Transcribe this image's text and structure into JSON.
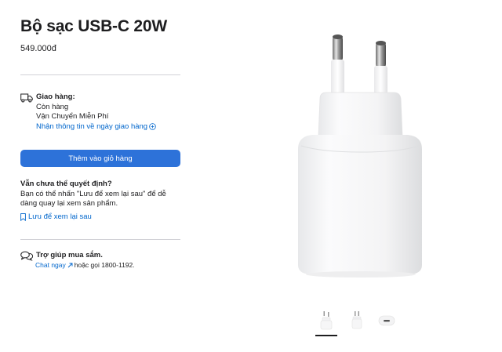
{
  "product": {
    "title": "Bộ sạc USB-C 20W",
    "price": "549.000đ"
  },
  "delivery": {
    "icon": "truck-icon",
    "heading": "Giao hàng:",
    "stock": "Còn hàng",
    "shipping": "Vận Chuyển Miễn Phí",
    "link_label": "Nhận thông tin về ngày giao hàng"
  },
  "cta": {
    "add_to_bag_label": "Thêm vào giỏ hàng",
    "color": "#2d72d9"
  },
  "save": {
    "heading": "Vẫn chưa thể quyết định?",
    "body_line1": "Bạn có thể nhấn \"Lưu để xem lại sau\" để dễ",
    "body_line2": "dàng quay lại xem sản phẩm.",
    "icon": "bookmark-icon",
    "link_label": "Lưu để xem lại sau"
  },
  "help": {
    "icon": "chat-bubbles-icon",
    "heading": "Trợ giúp mua sắm.",
    "chat_label": "Chat ngay",
    "phone_text": "hoặc gọi 1800-1192."
  },
  "gallery": {
    "thumbnails": [
      "charger-front",
      "charger-side",
      "charger-port"
    ],
    "selected": 0
  }
}
